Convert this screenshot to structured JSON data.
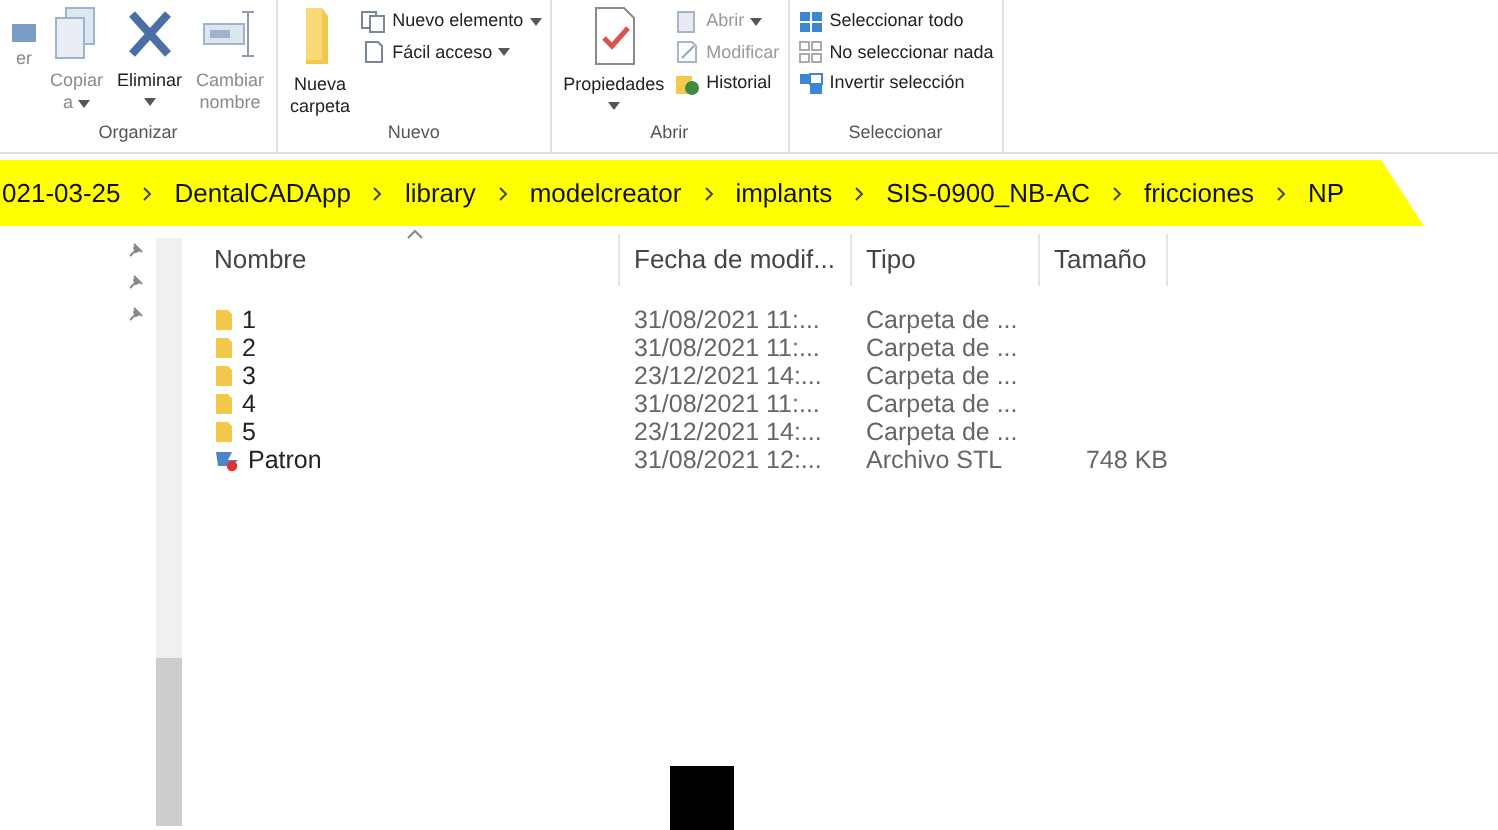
{
  "ribbon": {
    "groups": [
      {
        "label": "Organizar",
        "buttons": [
          {
            "kind": "large",
            "lines": [
              "er"
            ],
            "caret": false,
            "disabled": true
          },
          {
            "kind": "large",
            "lines": [
              "Copiar",
              "a"
            ],
            "caret": true,
            "disabled": true
          },
          {
            "kind": "large",
            "lines": [
              "Eliminar"
            ],
            "caret": true,
            "disabled": false
          },
          {
            "kind": "large",
            "lines": [
              "Cambiar",
              "nombre"
            ],
            "caret": false,
            "disabled": true
          }
        ]
      },
      {
        "label": "Nuevo",
        "buttons": [
          {
            "kind": "large",
            "lines": [
              "Nueva",
              "carpeta"
            ],
            "caret": false,
            "disabled": false
          },
          {
            "kind": "small",
            "lines": [
              "Nuevo elemento"
            ],
            "caret": true,
            "disabled": false
          },
          {
            "kind": "small",
            "lines": [
              "Fácil acceso"
            ],
            "caret": true,
            "disabled": false
          }
        ]
      },
      {
        "label": "Abrir",
        "buttons": [
          {
            "kind": "large",
            "lines": [
              "Propiedades"
            ],
            "caret": true,
            "disabled": false
          },
          {
            "kind": "small",
            "lines": [
              "Abrir"
            ],
            "caret": true,
            "disabled": true
          },
          {
            "kind": "small",
            "lines": [
              "Modificar"
            ],
            "caret": false,
            "disabled": true
          },
          {
            "kind": "small",
            "lines": [
              "Historial"
            ],
            "caret": false,
            "disabled": false
          }
        ]
      },
      {
        "label": "Seleccionar",
        "buttons": [
          {
            "kind": "small",
            "lines": [
              "Seleccionar todo"
            ],
            "caret": false,
            "disabled": false
          },
          {
            "kind": "small",
            "lines": [
              "No seleccionar nada"
            ],
            "caret": false,
            "disabled": false
          },
          {
            "kind": "small",
            "lines": [
              "Invertir selección"
            ],
            "caret": false,
            "disabled": false
          }
        ]
      }
    ]
  },
  "breadcrumb": [
    "021-03-25",
    "DentalCADApp",
    "library",
    "modelcreator",
    "implants",
    "SIS-0900_NB-AC",
    "fricciones",
    "NP"
  ],
  "columns": [
    "Nombre",
    "Fecha de modif...",
    "Tipo",
    "Tamaño"
  ],
  "files": [
    {
      "kind": "folder",
      "name": "1",
      "date": "31/08/2021 11:...",
      "type": "Carpeta de ..."
    },
    {
      "kind": "folder",
      "name": "2",
      "date": "31/08/2021 11:...",
      "type": "Carpeta de ..."
    },
    {
      "kind": "folder",
      "name": "3",
      "date": "23/12/2021 14:...",
      "type": "Carpeta de ..."
    },
    {
      "kind": "folder",
      "name": "4",
      "date": "31/08/2021 11:...",
      "type": "Carpeta de ..."
    },
    {
      "kind": "folder",
      "name": "5",
      "date": "23/12/2021 14:...",
      "type": "Carpeta de ..."
    },
    {
      "kind": "stl",
      "name": "Patron",
      "date": "31/08/2021 12:...",
      "type": "Archivo STL",
      "size": "748 KB"
    }
  ]
}
